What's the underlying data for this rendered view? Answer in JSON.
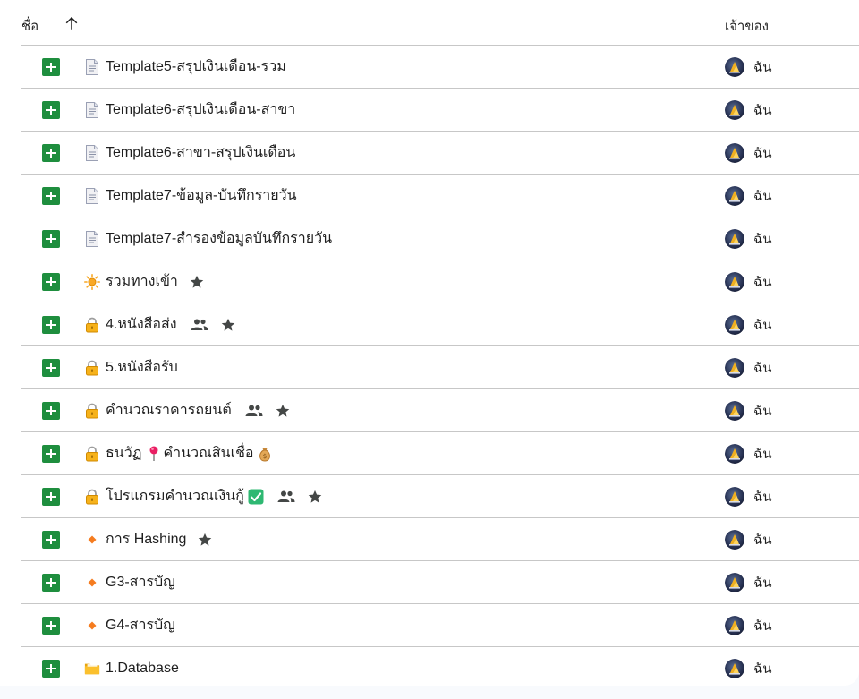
{
  "header": {
    "name_label": "ชื่อ",
    "owner_label": "เจ้าของ",
    "sort_direction": "ascending"
  },
  "colors": {
    "sheets_green": "#1e8e3e",
    "divider": "#c7c7c7",
    "text": "#1f1f1f",
    "icon_grey": "#444746"
  },
  "files": [
    {
      "name": "Template5-สรุปเงินเดือน-รวม",
      "prefix": "document-icon",
      "shared": false,
      "starred": false,
      "owner": "ฉัน"
    },
    {
      "name": "Template6-สรุปเงินเดือน-สาขา",
      "prefix": "document-icon",
      "shared": false,
      "starred": false,
      "owner": "ฉัน"
    },
    {
      "name": "Template6-สาขา-สรุปเงินเดือน",
      "prefix": "document-icon",
      "shared": false,
      "starred": false,
      "owner": "ฉัน"
    },
    {
      "name": "Template7-ข้อมูล-บันทึกรายวัน",
      "prefix": "document-icon",
      "shared": false,
      "starred": false,
      "owner": "ฉัน"
    },
    {
      "name": "Template7-สำรองข้อมูลบันทึกรายวัน",
      "prefix": "document-icon",
      "shared": false,
      "starred": false,
      "owner": "ฉัน"
    },
    {
      "name": "รวมทางเข้า",
      "prefix": "sun-icon",
      "shared": false,
      "starred": true,
      "owner": "ฉัน"
    },
    {
      "name": "4.หนังสือส่ง",
      "prefix": "lock-icon",
      "shared": true,
      "starred": true,
      "owner": "ฉัน"
    },
    {
      "name": "5.หนังสือรับ",
      "prefix": "lock-icon",
      "shared": false,
      "starred": false,
      "owner": "ฉัน"
    },
    {
      "name": "คำนวณราคารถยนต์",
      "prefix": "lock-icon",
      "shared": true,
      "starred": true,
      "owner": "ฉัน"
    },
    {
      "name": "ธนวัฏ",
      "prefix": "lock-icon",
      "name2": "คำนวณสินเชื่อ",
      "mid_icon": "pushpin-icon",
      "suffix": "money-bag-icon",
      "shared": false,
      "starred": false,
      "owner": "ฉัน"
    },
    {
      "name": "โปรแกรมคำนวณเงินกู้",
      "prefix": "lock-icon",
      "suffix": "check-mark-icon",
      "shared": true,
      "starred": true,
      "owner": "ฉัน"
    },
    {
      "name": "การ Hashing",
      "prefix": "orange-diamond-icon",
      "shared": false,
      "starred": true,
      "owner": "ฉัน"
    },
    {
      "name": "G3-สารบัญ",
      "prefix": "orange-diamond-icon",
      "shared": false,
      "starred": false,
      "owner": "ฉัน"
    },
    {
      "name": "G4-สารบัญ",
      "prefix": "orange-diamond-icon",
      "shared": false,
      "starred": false,
      "owner": "ฉัน"
    },
    {
      "name": "1.Database",
      "prefix": "folder-icon",
      "shared": false,
      "starred": false,
      "owner": "ฉัน"
    }
  ]
}
